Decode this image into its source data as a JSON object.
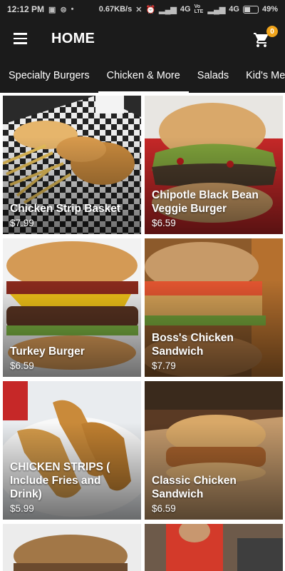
{
  "status_bar": {
    "time": "12:12 PM",
    "network_speed": "0.67KB/s",
    "network_1": "4G",
    "volte": "Vo LTE",
    "network_2": "4G",
    "battery": "49%",
    "battery_level": 0.49
  },
  "app_bar": {
    "title": "HOME",
    "cart_count": "0"
  },
  "tabs": [
    {
      "label": "Specialty Burgers",
      "active": false
    },
    {
      "label": "Chicken & More",
      "active": true
    },
    {
      "label": "Salads",
      "active": false
    },
    {
      "label": "Kid's Meals",
      "active": false
    }
  ],
  "items": [
    {
      "name": "Chicken Strip Basket",
      "price": "$7.99"
    },
    {
      "name": "Chipotle Black Bean Veggie Burger",
      "price": "$6.59"
    },
    {
      "name": "Turkey Burger",
      "price": "$6.59"
    },
    {
      "name": "Boss's Chicken Sandwich",
      "price": "$7.79"
    },
    {
      "name": "CHICKEN STRIPS ( Include Fries and Drink)",
      "price": "$5.99"
    },
    {
      "name": "Classic Chicken Sandwich",
      "price": "$6.59"
    },
    {
      "name": "",
      "price": ""
    },
    {
      "name": "",
      "price": ""
    }
  ],
  "colors": {
    "bar": "#1b1b1b",
    "badge": "#f0a41b",
    "text_on_dark": "#ffffff"
  }
}
